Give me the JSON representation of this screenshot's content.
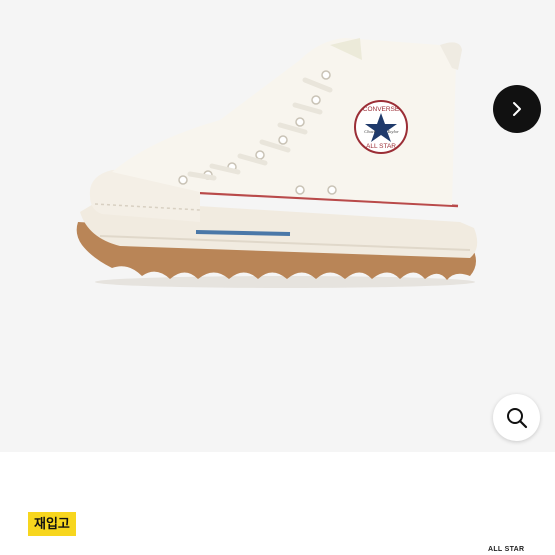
{
  "gallery": {
    "image_alt": "",
    "logo": {
      "top_text": "CONVERSE",
      "bottom_text": "ALL STAR",
      "script_left": "Chuck",
      "script_right": "Taylor"
    },
    "next_icon": "chevron-right-icon",
    "zoom_icon": "magnifier-icon"
  },
  "badge": {
    "label": "재입고",
    "color": "#f7d61e"
  },
  "partial_brand": {
    "text": "ALL STAR"
  }
}
